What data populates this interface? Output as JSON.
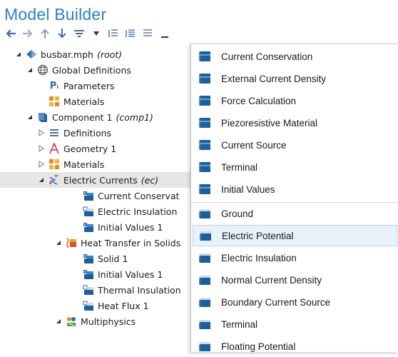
{
  "panel": {
    "title": "Model Builder"
  },
  "toolbar": {
    "buttons": [
      "arrow-left-icon",
      "arrow-right-icon",
      "arrow-up-icon",
      "arrow-down-icon",
      "show-filter-icon",
      "dropdown-icon",
      "collapse-all-icon",
      "expand-all-icon",
      "list-icon",
      "minus-icon"
    ]
  },
  "tree": {
    "items": [
      {
        "label": "busbar.mph",
        "tag": "(root)"
      },
      {
        "label": "Global Definitions"
      },
      {
        "label": "Parameters",
        "icon_text": "Pᵢ"
      },
      {
        "label": "Materials"
      },
      {
        "label": "Component 1",
        "tag": "(comp1)"
      },
      {
        "label": "Definitions"
      },
      {
        "label": "Geometry 1"
      },
      {
        "label": "Materials"
      },
      {
        "label": "Electric Currents",
        "tag": "(ec)"
      },
      {
        "label": "Current Conservat"
      },
      {
        "label": "Electric Insulation"
      },
      {
        "label": "Initial Values 1"
      },
      {
        "label": "Heat Transfer in Solids"
      },
      {
        "label": "Solid 1"
      },
      {
        "label": "Initial Values 1"
      },
      {
        "label": "Thermal Insulation"
      },
      {
        "label": "Heat Flux 1"
      },
      {
        "label": "Multiphysics"
      }
    ]
  },
  "menu": {
    "domain_items": [
      "Current Conservation",
      "External Current Density",
      "Force Calculation",
      "Piezoresistive Material",
      "Current Source",
      "Terminal",
      "Initial Values"
    ],
    "boundary_items": [
      "Ground",
      "Electric Potential",
      "Electric Insulation",
      "Normal Current Density",
      "Boundary Current Source",
      "Terminal",
      "Floating Potential"
    ],
    "highlighted": "Electric Potential"
  },
  "colors": {
    "title": "#2f7fc1",
    "icon_blue": "#1f5f99",
    "selection": "#e6e6e6",
    "hover": "#e9f2fb"
  }
}
